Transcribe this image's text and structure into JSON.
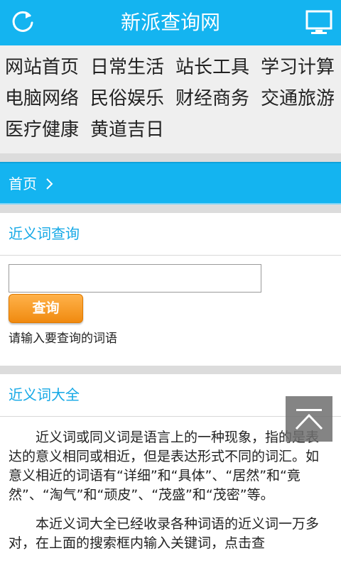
{
  "header": {
    "title": "新派查询网",
    "left_icon": "refresh-icon",
    "right_icon": "monitor-icon"
  },
  "nav": {
    "items": [
      "网站首页",
      "日常生活",
      "站长工具",
      "学习计算",
      "电脑网络",
      "民俗娱乐",
      "财经商务",
      "交通旅游",
      "医疗健康",
      "黄道吉日"
    ]
  },
  "breadcrumb": {
    "home": "首页",
    "separator_icon": "chevron-right-icon"
  },
  "query_section": {
    "title": "近义词查询",
    "input_value": "",
    "button_label": "查询",
    "hint": "请输入要查询的词语"
  },
  "about_section": {
    "title": "近义词大全",
    "paragraphs": [
      "近义词或同义词是语言上的一种现象，指的是表达的意义相同或相近，但是表达形式不同的词汇。如意义相近的词语有“详细”和“具体”、“居然”和“竟然”、“淘气”和“顽皮”、“茂盛”和“茂密”等。",
      "本近义词大全已经收录各种词语的近义词一万多对，在上面的搜索框内输入关键词，点击查"
    ]
  },
  "back_to_top_icon": "arrow-up-icon",
  "colors": {
    "brand": "#14b4f0",
    "section_title": "#14a8e6",
    "button": "#f08a10",
    "nav_bg": "#efefef"
  }
}
